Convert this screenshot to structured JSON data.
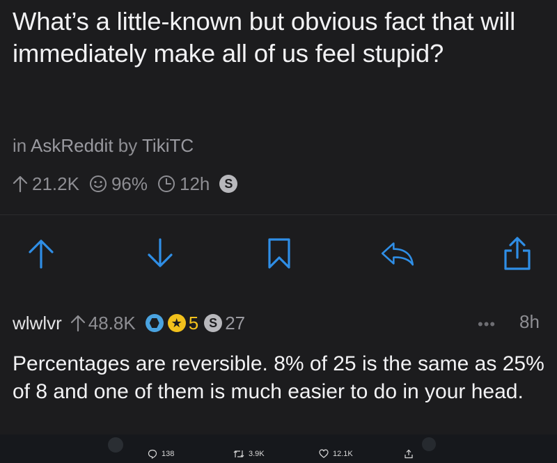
{
  "post": {
    "title": "What’s a little-known but obvious fact that will immediately make all of us feel stupid?",
    "in_label": "in",
    "subreddit": "AskReddit",
    "by_label": "by",
    "author": "TikiTC",
    "score": "21.2K",
    "upvote_ratio": "96%",
    "age": "12h",
    "award_glyph": "S"
  },
  "actions": {
    "color": "#2f8ee6",
    "items": [
      "upvote-icon",
      "downvote-icon",
      "bookmark-icon",
      "reply-icon",
      "share-icon"
    ]
  },
  "comment": {
    "author": "wlwlvr",
    "score": "48.8K",
    "gold_glyph": "★",
    "gold_count": "5",
    "silver_glyph": "S",
    "silver_count": "27",
    "more": "•••",
    "age": "8h",
    "body": "Percentages are reversible.  8% of 25 is the same as 25% of 8 and one of them is much easier to do in your head."
  },
  "tweet_bar": {
    "replies": "138",
    "retweets": "3.9K",
    "likes": "12.1K"
  }
}
